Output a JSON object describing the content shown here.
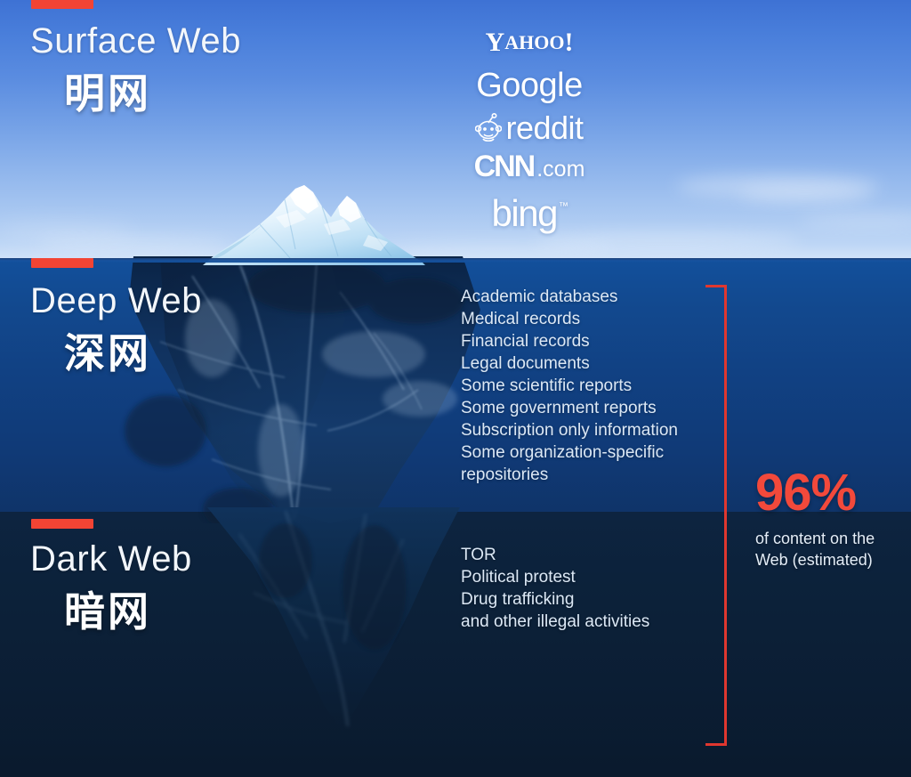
{
  "sections": [
    {
      "id": "surface",
      "title_en": "Surface Web",
      "title_cn": "明网"
    },
    {
      "id": "deep",
      "title_en": "Deep Web",
      "title_cn": "深网"
    },
    {
      "id": "dark",
      "title_en": "Dark Web",
      "title_cn": "暗网"
    }
  ],
  "brands": [
    {
      "name": "yahoo-logo",
      "part1": "Y",
      "part2": "AHOO",
      "part3": "!"
    },
    {
      "name": "google-logo",
      "text": "Google"
    },
    {
      "name": "reddit-logo",
      "text": "reddit"
    },
    {
      "name": "cnn-logo",
      "text": "CNN",
      "suffix": ".com"
    },
    {
      "name": "bing-logo",
      "text": "bing",
      "tm": "™"
    }
  ],
  "deep_items": [
    "Academic databases",
    "Medical records",
    "Financial records",
    "Legal documents",
    "Some scientific reports",
    "Some government reports",
    "Subscription only information",
    "Some organization-specific",
    "repositories"
  ],
  "dark_items": [
    "TOR",
    "Political protest",
    "Drug trafficking",
    "and other illegal activities"
  ],
  "callout": {
    "percent": "96%",
    "line1": "of content on the",
    "line2": "Web (estimated)"
  },
  "colors": {
    "accent_red": "#f24434",
    "bracket_red": "#e0372f",
    "percent_red": "#f2493b",
    "sky_blue": "#4a7fdb",
    "deep_blue": "#12509c",
    "dark_navy": "#0c2139",
    "text_white": "#ffffff",
    "list_text": "#dce8f5"
  }
}
